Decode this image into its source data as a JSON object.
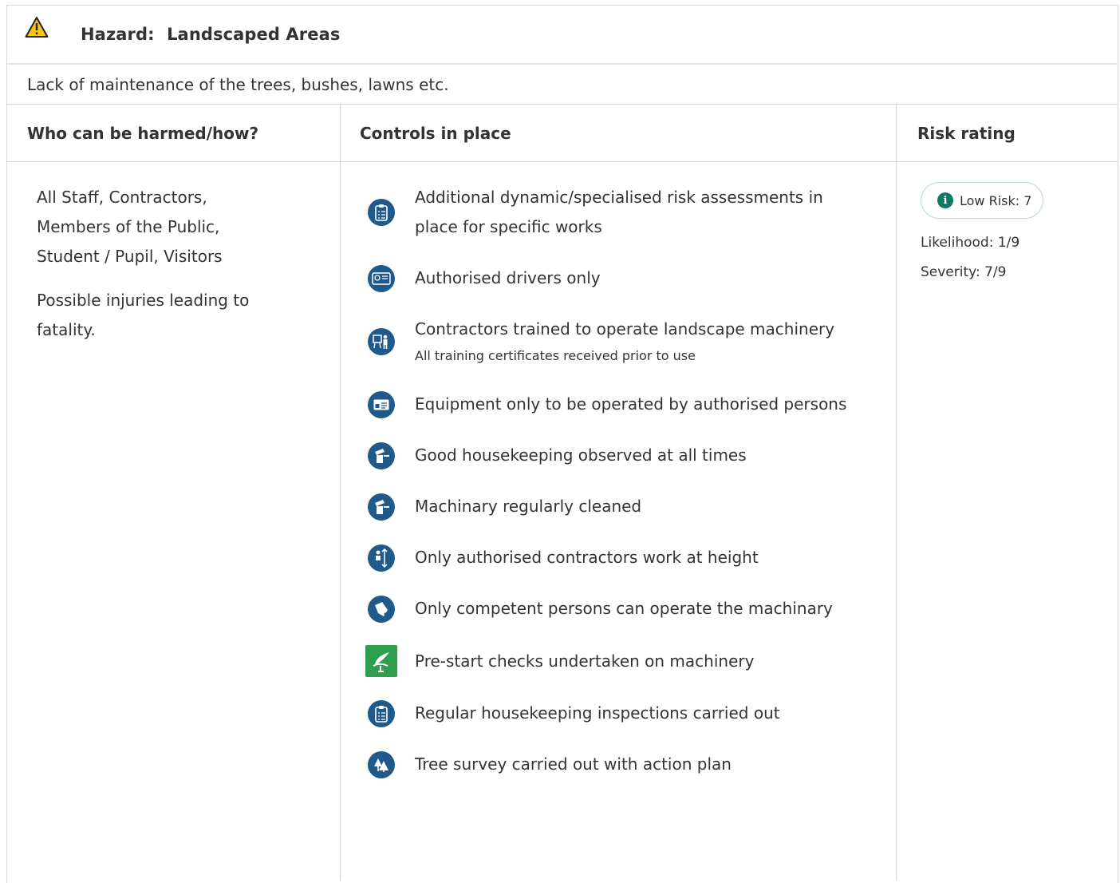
{
  "hazard": {
    "label": "Hazard:",
    "name": "Landscaped Areas",
    "description": "Lack of maintenance of the trees, bushes, lawns etc."
  },
  "columns": {
    "who": "Who can be harmed/how?",
    "controls": "Controls in place",
    "risk": "Risk rating"
  },
  "who": {
    "groups": "All Staff, Contractors, Members of the Public, Student / Pupil, Visitors",
    "harm": "Possible injuries leading to fatality."
  },
  "controls": [
    {
      "icon": "clipboard-checklist-icon",
      "text": "Additional dynamic/specialised risk assessments in place for specific works"
    },
    {
      "icon": "id-pass-icon",
      "text": "Authorised drivers only"
    },
    {
      "icon": "training-presentation-icon",
      "text": "Contractors trained to operate landscape machinery",
      "note": "All training certificates received prior to use"
    },
    {
      "icon": "id-card-icon",
      "text": "Equipment only to be operated by authorised persons"
    },
    {
      "icon": "housekeeping-icon",
      "text": "Good housekeeping observed at all times"
    },
    {
      "icon": "cleaning-icon",
      "text": "Machinary regularly cleaned"
    },
    {
      "icon": "work-at-height-icon",
      "text": "Only authorised contractors work at height"
    },
    {
      "icon": "competent-person-icon",
      "text": "Only competent persons can operate the machinary"
    },
    {
      "icon": "pre-start-check-icon",
      "text": "Pre-start checks undertaken on machinery"
    },
    {
      "icon": "inspection-clipboard-icon",
      "text": "Regular housekeeping inspections carried out"
    },
    {
      "icon": "tree-survey-icon",
      "text": "Tree survey carried out with action plan"
    }
  ],
  "risk": {
    "badge": "Low Risk: 7",
    "likelihood": "Likelihood: 1/9",
    "severity": "Severity: 7/9"
  },
  "colors": {
    "icon_blue": "#1f5a8a",
    "icon_green": "#2e9e4e",
    "risk_low": "#0f7a64",
    "warning": "#f5c518"
  }
}
